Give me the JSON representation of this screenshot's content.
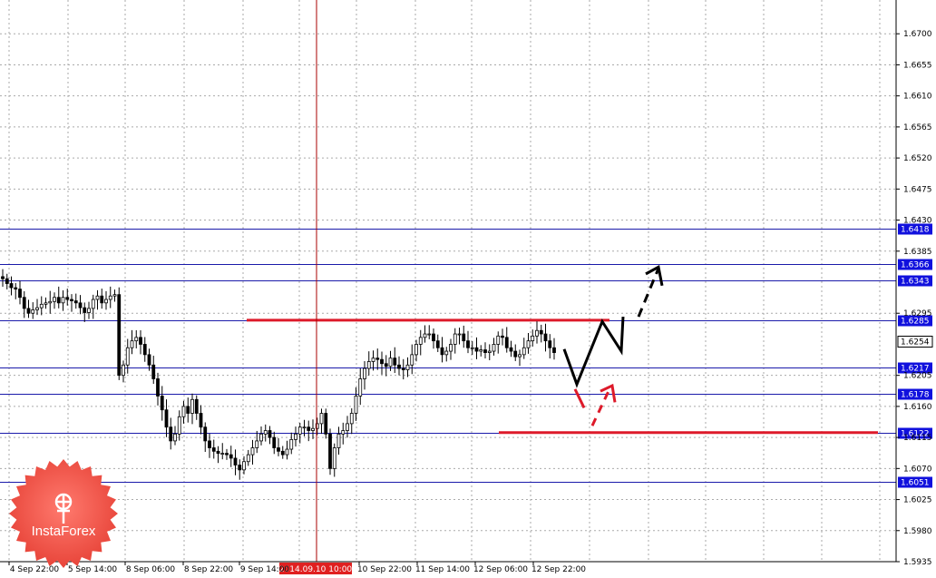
{
  "chart_data": {
    "type": "candlestick",
    "y_axis_ticks": [
      "1.6700",
      "1.6655",
      "1.6610",
      "1.6565",
      "1.6520",
      "1.6475",
      "1.6430",
      "1.6385",
      "1.6295",
      "1.6205",
      "1.6160",
      "1.6115",
      "1.6070",
      "1.6025",
      "1.5980",
      "1.5935"
    ],
    "ylim": [
      1.5935,
      1.6745
    ],
    "x_axis_labels": [
      "4 Sep 22:00",
      "5 Sep 14:00",
      "8 Sep 06:00",
      "8 Sep 22:00",
      "9 Sep 14:00",
      "10 Sep 22:00",
      "11 Sep 14:00",
      "12 Sep 06:00",
      "12 Sep 22:00"
    ],
    "cursor_label": "2014.09.10 10:00",
    "levels": [
      {
        "label": "1.6418",
        "value": 1.6418
      },
      {
        "label": "1.6366",
        "value": 1.6366
      },
      {
        "label": "1.6343",
        "value": 1.6343
      },
      {
        "label": "1.6285",
        "value": 1.6285
      },
      {
        "label": "1.6217",
        "value": 1.6217
      },
      {
        "label": "1.6178",
        "value": 1.6178
      },
      {
        "label": "1.6122",
        "value": 1.6122
      },
      {
        "label": "1.6051",
        "value": 1.6051
      }
    ],
    "current_price": "1.6254",
    "close_path": [
      1.6345,
      1.6338,
      1.6332,
      1.633,
      1.6318,
      1.6302,
      1.6295,
      1.63,
      1.6303,
      1.6308,
      1.631,
      1.6312,
      1.6318,
      1.631,
      1.6318,
      1.6315,
      1.6313,
      1.631,
      1.6303,
      1.6296,
      1.6302,
      1.6315,
      1.632,
      1.631,
      1.6315,
      1.632,
      1.6322,
      1.6205,
      1.622,
      1.6245,
      1.6255,
      1.626,
      1.625,
      1.6235,
      1.622,
      1.62,
      1.6175,
      1.6155,
      1.613,
      1.611,
      1.612,
      1.6145,
      1.616,
      1.615,
      1.617,
      1.615,
      1.613,
      1.611,
      1.61,
      1.6095,
      1.6092,
      1.6092,
      1.609,
      1.6085,
      1.6075,
      1.6068,
      1.608,
      1.609,
      1.61,
      1.611,
      1.612,
      1.6125,
      1.6115,
      1.61,
      1.6095,
      1.609,
      1.6098,
      1.6112,
      1.612,
      1.613,
      1.613,
      1.6125,
      1.6128,
      1.6135,
      1.615,
      1.612,
      1.607,
      1.61,
      1.612,
      1.6125,
      1.6135,
      1.615,
      1.6175,
      1.62,
      1.6215,
      1.6225,
      1.623,
      1.6228,
      1.6222,
      1.6218,
      1.623,
      1.622,
      1.6215,
      1.6213,
      1.622,
      1.6235,
      1.625,
      1.626,
      1.6265,
      1.6265,
      1.6255,
      1.6245,
      1.6235,
      1.624,
      1.625,
      1.6265,
      1.6265,
      1.6255,
      1.6245,
      1.6245,
      1.624,
      1.6242,
      1.6238,
      1.624,
      1.625,
      1.6262,
      1.626,
      1.6245,
      1.624,
      1.6232,
      1.6235,
      1.6245,
      1.6255,
      1.6262,
      1.627,
      1.6265,
      1.6255,
      1.6245,
      1.6238
    ],
    "forecast_levels": [
      1.6285,
      1.6122
    ],
    "forecast_black_path": [
      1.6243,
      1.6192,
      1.6283,
      1.624,
      1.629
    ],
    "forecast_black_dashed": [
      1.629,
      1.636,
      1.6333
    ],
    "forecast_red_dashed": [
      1.615,
      1.619,
      1.617
    ],
    "colors": {
      "bull": "#000000",
      "bear": "#000000",
      "level_line": "#1a1aaa",
      "level_label_bg": "#1010dd",
      "cursor": "#aa0000",
      "cursor_label_bg": "#e02020",
      "forecast_red": "#dd1a2a",
      "grid": "#aaaaaa"
    }
  },
  "watermark": {
    "text": "InstaForex"
  }
}
